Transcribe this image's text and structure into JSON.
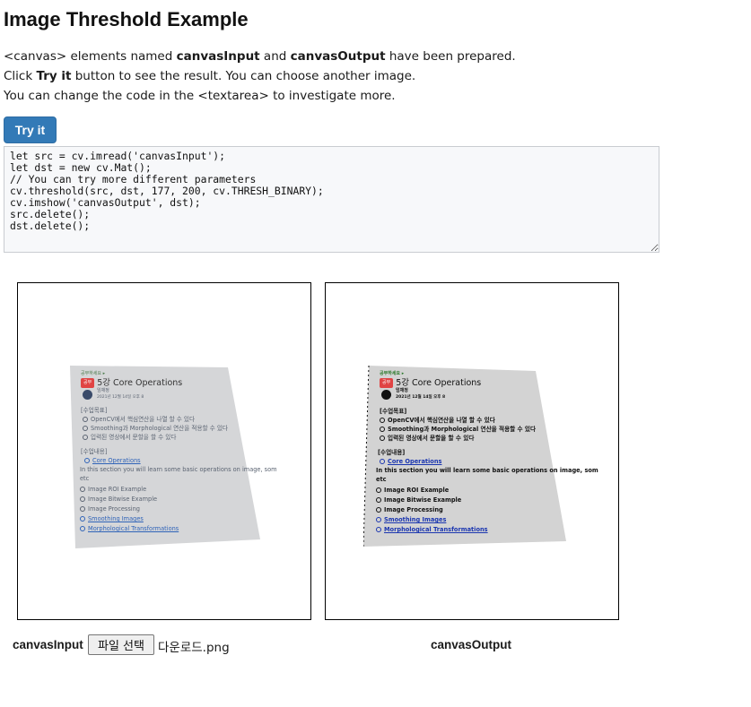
{
  "page": {
    "title": "Image Threshold Example",
    "intro": {
      "line1_pre": "<canvas> elements named ",
      "line1_b1": "canvasInput",
      "line1_mid": " and ",
      "line1_b2": "canvasOutput",
      "line1_post": " have been prepared.",
      "line2_pre": "Click ",
      "line2_b": "Try it",
      "line2_post": " button to see the result. You can choose another image.",
      "line3": "You can change the code in the <textarea> to investigate more."
    },
    "try_button": "Try it",
    "code": "let src = cv.imread('canvasInput');\nlet dst = new cv.Mat();\n// You can try more different parameters\ncv.threshold(src, dst, 177, 200, cv.THRESH_BINARY);\ncv.imshow('canvasOutput', dst);\nsrc.delete();\ndst.delete();",
    "input_label": "canvasInput",
    "file_button": "파일 선택",
    "file_name": "다운로드.png",
    "output_label": "canvasOutput"
  },
  "document_image": {
    "header": "공부하세요 ▸",
    "badge": "공부",
    "title": "5강 Core Operations",
    "author": "임채정",
    "date": "2021년 12월 14일 오후 8",
    "section1_head": "[수업목표]",
    "goals": [
      "OpenCV에서 핵심연산을 나열 할 수 있다",
      "Smoothing과 Morphological 연산을 적용할 수 있다",
      "입력된 영상에서 문할을 할 수 있다"
    ],
    "section2_head": "[수업내용]",
    "core_link": "Core Operations",
    "sentence1": "In this section you will learn some basic operations on image, som",
    "sentence2": "etc",
    "items": [
      {
        "label": "Image ROI Example",
        "link": false
      },
      {
        "label": "Image Bitwise Example",
        "link": false
      },
      {
        "label": "Image Processing",
        "link": false
      },
      {
        "label": "Smoothing Images",
        "link": true
      },
      {
        "label": "Morphological Transformations",
        "link": true
      }
    ]
  },
  "colors": {
    "button_bg": "#337ab7",
    "textarea_bg": "#f7f8fa",
    "link": "#2f63b8"
  }
}
